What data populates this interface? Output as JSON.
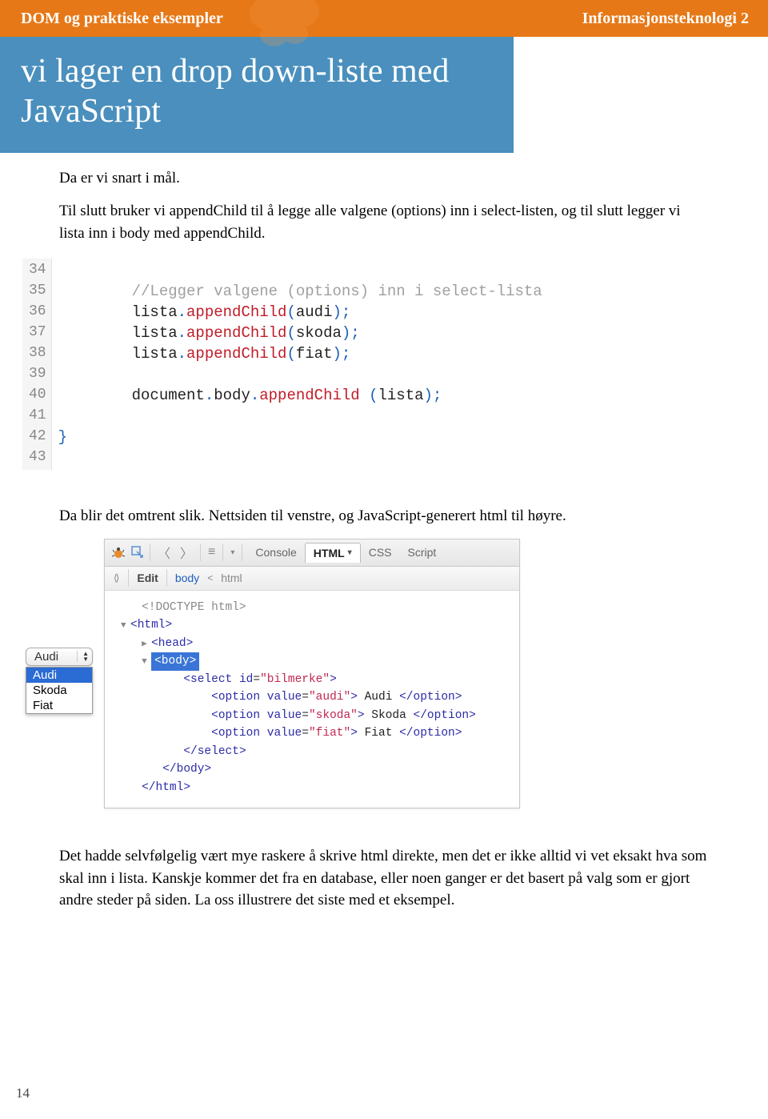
{
  "header": {
    "left": "DOM og praktiske eksempler",
    "right": "Informasjonsteknologi 2"
  },
  "title": "vi lager en drop down-liste med JavaScript",
  "paragraphs": {
    "p1": "Da er vi snart i mål.",
    "p2": "Til slutt bruker vi appendChild til å legge alle valgene (options) inn i select-listen, og til slutt legger vi lista inn i body med appendChild.",
    "p3": "Da blir det omtrent slik. Nettsiden til venstre, og JavaScript-generert html til høyre.",
    "p4": "Det hadde selvfølgelig vært mye raskere å skrive html direkte, men det er ikke alltid vi vet eksakt hva som skal inn i lista. Kanskje kommer det fra en database, eller noen ganger er det basert på valg som er gjort andre steder på siden. La oss illustrere det siste med et eksempel."
  },
  "code1": {
    "gutter": [
      "34",
      "35",
      "36",
      "37",
      "38",
      "39",
      "40",
      "41",
      "42",
      "43"
    ],
    "lines": [
      {
        "type": "blank",
        "text": ""
      },
      {
        "type": "comment",
        "text": "//Legger valgene (options) inn i select-lista"
      },
      {
        "type": "stmt",
        "obj": "lista",
        "method": "appendChild",
        "arg": "audi"
      },
      {
        "type": "stmt",
        "obj": "lista",
        "method": "appendChild",
        "arg": "skoda"
      },
      {
        "type": "stmt",
        "obj": "lista",
        "method": "appendChild",
        "arg": "fiat"
      },
      {
        "type": "blank",
        "text": ""
      },
      {
        "type": "stmt2",
        "obj1": "document",
        "obj2": "body",
        "method": "appendChild",
        "arg": "lista"
      },
      {
        "type": "blank",
        "text": ""
      },
      {
        "type": "brace",
        "text": "}"
      },
      {
        "type": "blank",
        "text": ""
      }
    ]
  },
  "dropdown": {
    "button": "Audi",
    "options": [
      "Audi",
      "Skoda",
      "Fiat"
    ]
  },
  "firebug": {
    "tabs": {
      "console": "Console",
      "html": "HTML",
      "css": "CSS",
      "script": "Script"
    },
    "subbar": {
      "edit": "Edit",
      "crumb1": "body",
      "crumb2": "html"
    },
    "subbar_marker": "⟨ ⟩",
    "htmlTree": {
      "doctype": "<!DOCTYPE html>",
      "htmlOpen": "<html>",
      "head": "<head>",
      "bodyOpen": "<body>",
      "selectOpen": {
        "tag": "select",
        "attr": "id",
        "val": "bilmerke"
      },
      "options": [
        {
          "val": "audi",
          "text": "Audi"
        },
        {
          "val": "skoda",
          "text": "Skoda"
        },
        {
          "val": "fiat",
          "text": "Fiat"
        }
      ],
      "selectClose": "</select>",
      "bodyClose": "</body>",
      "htmlClose": "</html>"
    }
  },
  "pageNumber": "14"
}
